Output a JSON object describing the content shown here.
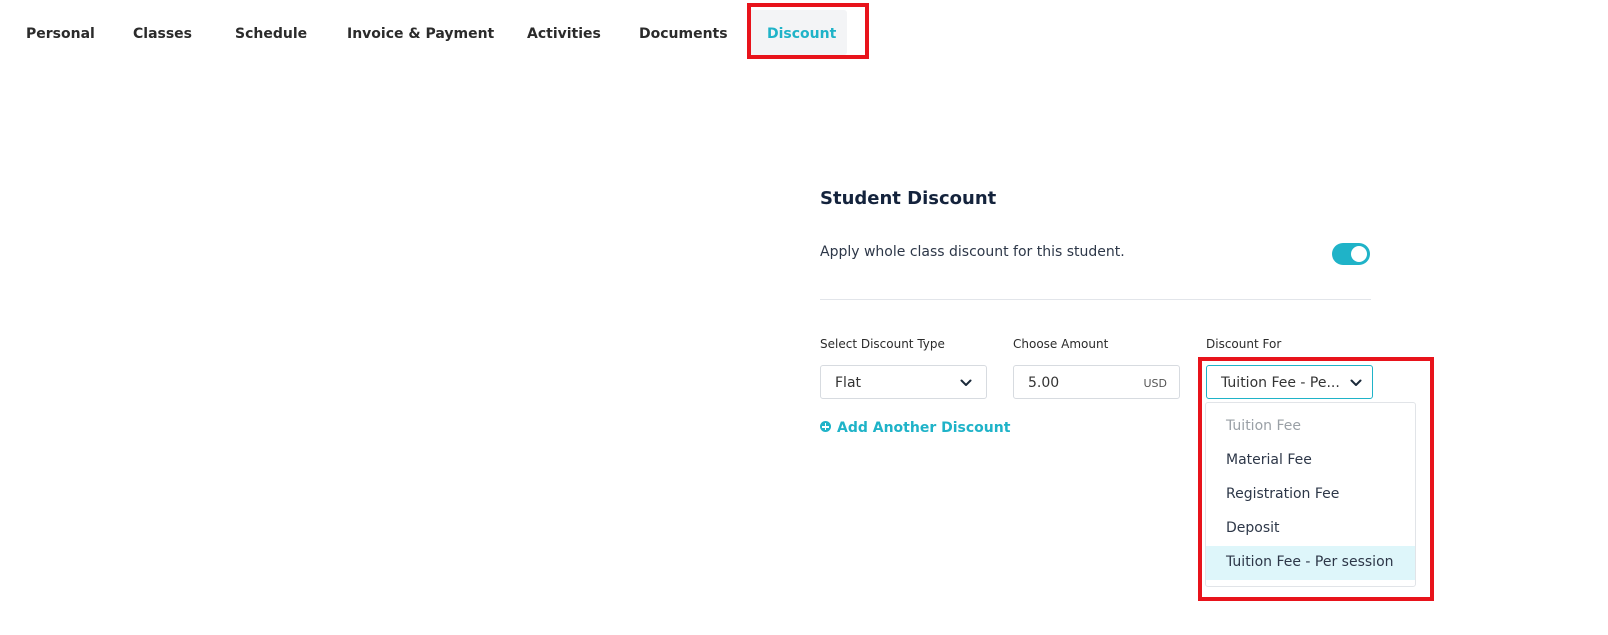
{
  "tabs": [
    {
      "label": "Personal",
      "active": false
    },
    {
      "label": "Classes",
      "active": false
    },
    {
      "label": "Schedule",
      "active": false
    },
    {
      "label": "Invoice & Payment",
      "active": false
    },
    {
      "label": "Activities",
      "active": false
    },
    {
      "label": "Documents",
      "active": false
    },
    {
      "label": "Discount",
      "active": true
    }
  ],
  "section": {
    "title": "Student Discount",
    "apply_text": "Apply whole class discount for this student.",
    "toggle_on": true
  },
  "fields": {
    "discount_type": {
      "label": "Select Discount Type",
      "value": "Flat"
    },
    "amount": {
      "label": "Choose Amount",
      "value": "5.00",
      "unit": "USD"
    },
    "discount_for": {
      "label": "Discount For",
      "value": "Tuition Fee - Pe..."
    }
  },
  "add_link": "Add Another Discount",
  "dropdown": {
    "options": [
      {
        "label": "Tuition Fee",
        "state": "disabled"
      },
      {
        "label": "Material Fee",
        "state": "normal"
      },
      {
        "label": "Registration Fee",
        "state": "normal"
      },
      {
        "label": "Deposit",
        "state": "normal"
      },
      {
        "label": "Tuition Fee - Per session",
        "state": "selected"
      }
    ]
  },
  "colors": {
    "accent": "#1fb3c8",
    "highlight": "#e8131b",
    "selected_bg": "#def6fa"
  },
  "icons": {
    "chevron": "chevron-down-icon",
    "add": "plus-circle-icon"
  }
}
